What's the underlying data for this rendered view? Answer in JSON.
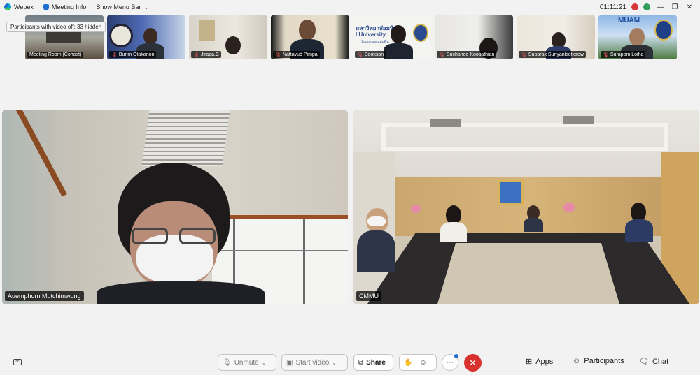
{
  "titlebar": {
    "app_name": "Webex",
    "meeting_info": "Meeting Info",
    "menu_bar": "Show Menu Bar",
    "timer": "01:11:21"
  },
  "tooltip": "Participants with video off: 33 hidden",
  "thumbnails": [
    {
      "name": "Meeting Room (Cohost)",
      "muted": false
    },
    {
      "name": "Burim Otakanon",
      "muted": true
    },
    {
      "name": "Jirapa.C",
      "muted": true
    },
    {
      "name": "Nattavud Pimpa",
      "muted": true
    },
    {
      "name": "Sooksan",
      "muted": true
    },
    {
      "name": "Suchanee Koosathian",
      "muted": true
    },
    {
      "name": "Suparak Suriyankietkaew",
      "muted": true
    },
    {
      "name": "Surapom Loiha",
      "muted": true
    }
  ],
  "thumb_text": {
    "sooksan_banner": "มหาวิทยาลัยมหิดล\nl University",
    "sooksan_sub": "ปัญญาของแผ่นดิน",
    "surapom_banner": "MUAM"
  },
  "main_videos": {
    "left_name": "Auemphorn Mutchimwong",
    "right_name": "CMMU"
  },
  "controls": {
    "unmute": "Unmute",
    "start_video": "Start video",
    "share": "Share",
    "apps": "Apps",
    "participants": "Participants",
    "chat": "Chat"
  },
  "colors": {
    "leave": "#d9312e",
    "background": "#f2f2f2"
  }
}
